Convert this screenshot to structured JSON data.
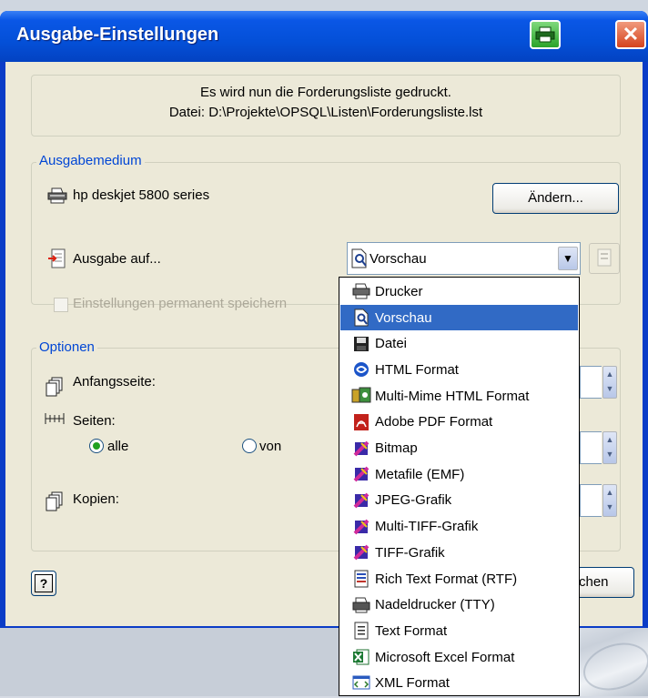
{
  "window": {
    "title": "Ausgabe-Einstellungen"
  },
  "info": {
    "line1": "Es wird nun die Forderungsliste gedruckt.",
    "line2": "Datei:  D:\\Projekte\\OPSQL\\Listen\\Forderungsliste.lst"
  },
  "medium": {
    "group_label": "Ausgabemedium",
    "printer_name": "hp deskjet 5800 series",
    "change_button": "Ändern...",
    "output_label": "Ausgabe auf...",
    "output_selected": "Vorschau",
    "checkbox_label": "Einstellungen permanent speichern",
    "checkbox_checked": false,
    "checkbox_enabled": false
  },
  "options": {
    "group_label": "Optionen",
    "start_page_label": "Anfangsseite:",
    "pages_label": "Seiten:",
    "radio_all": "alle",
    "radio_from": "von",
    "radio_selected": "alle",
    "copies_label": "Kopien:"
  },
  "footer": {
    "help_button": "?",
    "cancel_button_visible": "chen"
  },
  "dropdown": {
    "selected": "Vorschau",
    "items": [
      {
        "label": "Drucker",
        "icon": "printer-icon"
      },
      {
        "label": "Vorschau",
        "icon": "preview-icon"
      },
      {
        "label": "Datei",
        "icon": "floppy-disk-icon"
      },
      {
        "label": "HTML Format",
        "icon": "html-icon"
      },
      {
        "label": "Multi-Mime HTML Format",
        "icon": "multi-mime-icon"
      },
      {
        "label": "Adobe PDF Format",
        "icon": "pdf-icon"
      },
      {
        "label": "Bitmap",
        "icon": "bitmap-icon"
      },
      {
        "label": "Metafile (EMF)",
        "icon": "metafile-icon"
      },
      {
        "label": "JPEG-Grafik",
        "icon": "jpeg-icon"
      },
      {
        "label": "Multi-TIFF-Grafik",
        "icon": "multi-tiff-icon"
      },
      {
        "label": "TIFF-Grafik",
        "icon": "tiff-icon"
      },
      {
        "label": "Rich Text Format (RTF)",
        "icon": "rtf-icon"
      },
      {
        "label": "Nadeldrucker (TTY)",
        "icon": "dot-matrix-printer-icon"
      },
      {
        "label": "Text Format",
        "icon": "text-file-icon"
      },
      {
        "label": "Microsoft Excel Format",
        "icon": "excel-icon"
      },
      {
        "label": "XML Format",
        "icon": "xml-icon"
      }
    ]
  },
  "colors": {
    "titlebar": "#0a57e6",
    "selection": "#316ac5",
    "group_label": "#0046d5",
    "dialog_face": "#ece9d8"
  }
}
